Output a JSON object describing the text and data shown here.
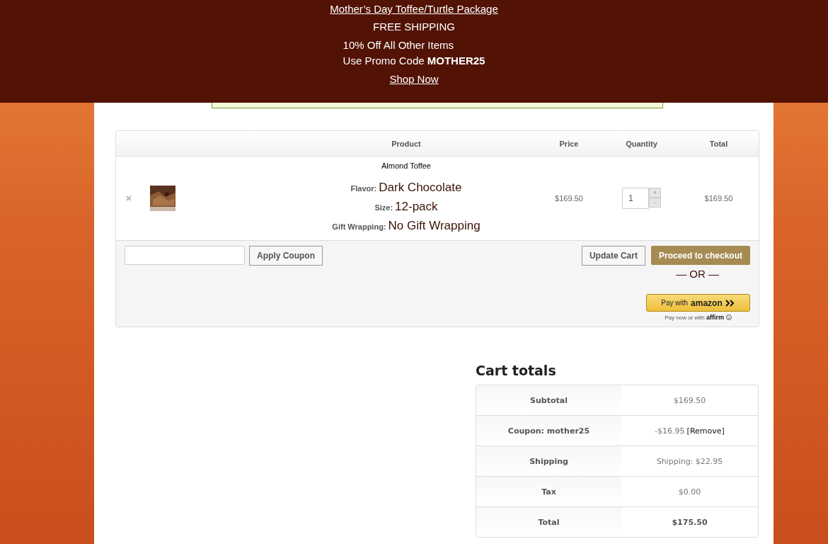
{
  "banner": {
    "title_link": "Mother’s Day Toffee/Turtle Package",
    "lines": [
      "FREE SHIPPING",
      "10% Off All Other Items",
      "Use Promo Code **MOTHER25**"
    ],
    "cta_link": "Shop Now"
  },
  "notice": {
    "kind": "notice"
  },
  "cart": {
    "columns": [
      "Product",
      "Price",
      "Quantity",
      "Total"
    ],
    "rows": [
      {
        "name": "Almond Toffee",
        "thumbnail": {
          "kind": "picture"
        },
        "attributes": [
          {
            "label": "Flavor:",
            "value": "Dark Chocolate"
          },
          {
            "label": "Size:",
            "value": "12-pack"
          },
          {
            "label": "Gift Wrapping:",
            "value": "No Gift Wrapping"
          }
        ],
        "price": "$169.50",
        "quantity": "1",
        "increment": "+",
        "decrement": "-",
        "total": "$169.50"
      }
    ],
    "coupon": {
      "button": "Apply Coupon"
    },
    "update_button": "Update Cart",
    "checkout_button": "Proceed to checkout",
    "or_label": "— OR —",
    "amazon": {
      "prefix": "Pay with",
      "brand": "amazon"
    },
    "affirm": {
      "text": "Pay now or with",
      "brand": "affirm"
    }
  },
  "totals": {
    "title": "Cart totals",
    "rows": [
      {
        "label": "Subtotal",
        "value": "$169.50",
        "bold": false
      },
      {
        "label": "Coupon: mother25",
        "value": "-$16.95",
        "link": "[Remove]",
        "bold": false
      },
      {
        "label": "Shipping",
        "value": "Shipping: $22.95",
        "bold": false
      },
      {
        "label": "Tax",
        "value": "$0.00",
        "bold": false
      },
      {
        "label": "Total",
        "value": "$175.50",
        "bold": true
      }
    ]
  }
}
